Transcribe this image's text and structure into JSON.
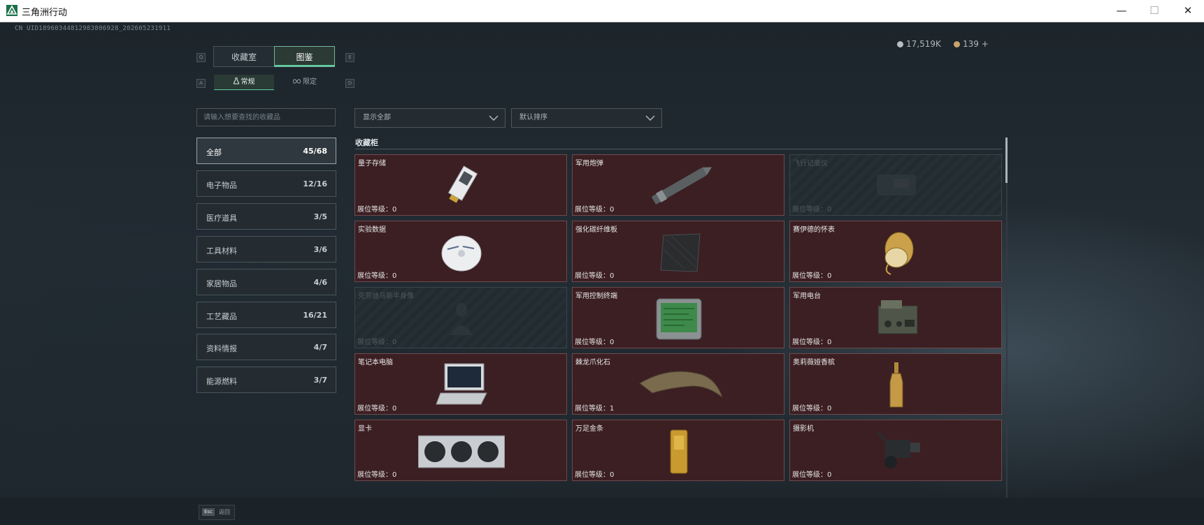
{
  "window": {
    "title": "三角洲行动",
    "minimize": "—",
    "maximize": "☐",
    "close": "✕"
  },
  "uid": "CN UID18960344812983806928_202605231911",
  "currency": [
    {
      "value": "17,519K",
      "color": "#b8bec2"
    },
    {
      "value": "139 +",
      "color": "#c8a46a"
    }
  ],
  "key_hints": {
    "q": "Q",
    "e": "E",
    "a": "A",
    "d": "D"
  },
  "main_tabs": [
    {
      "label": "收藏室",
      "active": false
    },
    {
      "label": "图鉴",
      "active": true
    }
  ],
  "sub_tabs": [
    {
      "label": "常规",
      "icon": "flask-icon",
      "active": true
    },
    {
      "label": "限定",
      "icon": "infinity-icon",
      "active": false
    }
  ],
  "search": {
    "placeholder": "请输入想要查找的收藏品",
    "value": ""
  },
  "filters": {
    "display": {
      "value": "显示全部"
    },
    "sort": {
      "value": "默认排序"
    }
  },
  "categories": [
    {
      "label": "全部",
      "count": "45/68",
      "active": true
    },
    {
      "label": "电子物品",
      "count": "12/16"
    },
    {
      "label": "医疗道具",
      "count": "3/5"
    },
    {
      "label": "工具材料",
      "count": "3/6"
    },
    {
      "label": "家居物品",
      "count": "4/6"
    },
    {
      "label": "工艺藏品",
      "count": "16/21"
    },
    {
      "label": "资料情报",
      "count": "4/7"
    },
    {
      "label": "能源燃料",
      "count": "3/7"
    }
  ],
  "section_title": "收藏柜",
  "level_label": "展位等级：",
  "items": [
    {
      "name": "量子存储",
      "level": "0",
      "locked": false,
      "icon": "ssd-icon"
    },
    {
      "name": "军用炮弹",
      "level": "0",
      "locked": false,
      "icon": "shell-icon"
    },
    {
      "name": "飞行记录仪",
      "level": "0",
      "locked": true,
      "icon": "recorder-icon"
    },
    {
      "name": "实验数据",
      "level": "0",
      "locked": false,
      "icon": "disc-icon"
    },
    {
      "name": "强化碳纤维板",
      "level": "0",
      "locked": false,
      "icon": "carbon-plate-icon"
    },
    {
      "name": "赛伊德的怀表",
      "level": "0",
      "locked": false,
      "icon": "pocket-watch-icon"
    },
    {
      "name": "克劳迪乌斯半身像",
      "level": "0",
      "locked": true,
      "icon": "bust-icon"
    },
    {
      "name": "军用控制终端",
      "level": "0",
      "locked": false,
      "icon": "terminal-icon"
    },
    {
      "name": "军用电台",
      "level": "0",
      "locked": false,
      "icon": "radio-icon"
    },
    {
      "name": "笔记本电脑",
      "level": "0",
      "locked": false,
      "icon": "laptop-icon"
    },
    {
      "name": "棘龙爪化石",
      "level": "1",
      "locked": false,
      "icon": "claw-fossil-icon"
    },
    {
      "name": "奥莉薇娅香槟",
      "level": "0",
      "locked": false,
      "icon": "champagne-icon"
    },
    {
      "name": "显卡",
      "level": "0",
      "locked": false,
      "icon": "gpu-icon"
    },
    {
      "name": "万足金条",
      "level": "0",
      "locked": false,
      "icon": "gold-bar-icon"
    },
    {
      "name": "摄影机",
      "level": "0",
      "locked": false,
      "icon": "camera-icon"
    }
  ],
  "footer": {
    "esc_key": "Esc",
    "esc_label": "返回"
  }
}
